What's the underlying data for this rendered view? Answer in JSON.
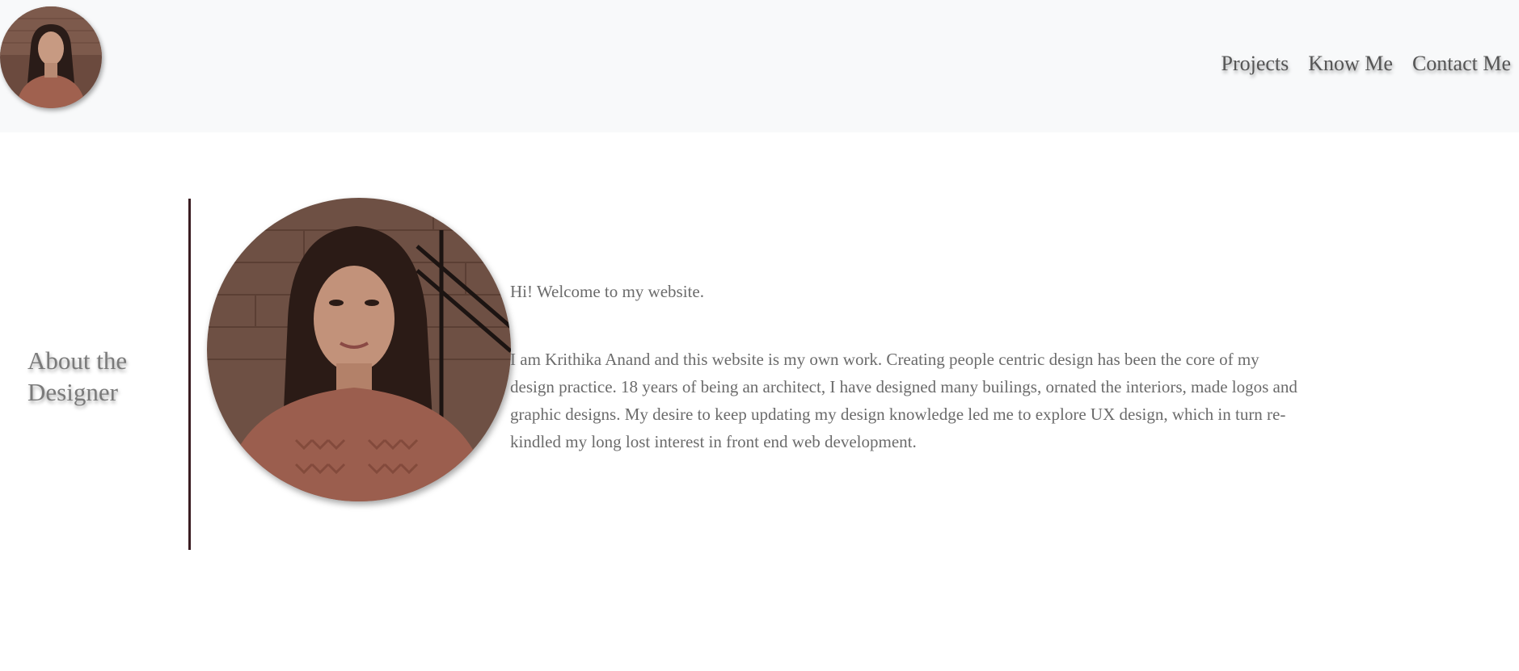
{
  "header": {
    "avatar_icon": "profile-photo-icon",
    "nav": {
      "projects": "Projects",
      "know_me": "Know Me",
      "contact_me": "Contact Me"
    }
  },
  "about": {
    "title": "About the Designer",
    "portrait_icon": "profile-photo-icon",
    "greeting": "Hi! Welcome to my website.",
    "bio": "I am Krithika Anand and this website is my own work. Creating people centric design has been the core of my design practice. 18 years of being an architect, I have designed many builings, ornated the interiors, made logos and graphic designs. My desire to keep updating my design knowledge led me to explore UX design, which in turn re-kindled my long lost interest in front end web development."
  },
  "colors": {
    "navbar_bg": "#f8f9fa",
    "divider": "#3a1d22",
    "text": "#6b6b6b",
    "title": "#7a7a7a"
  }
}
